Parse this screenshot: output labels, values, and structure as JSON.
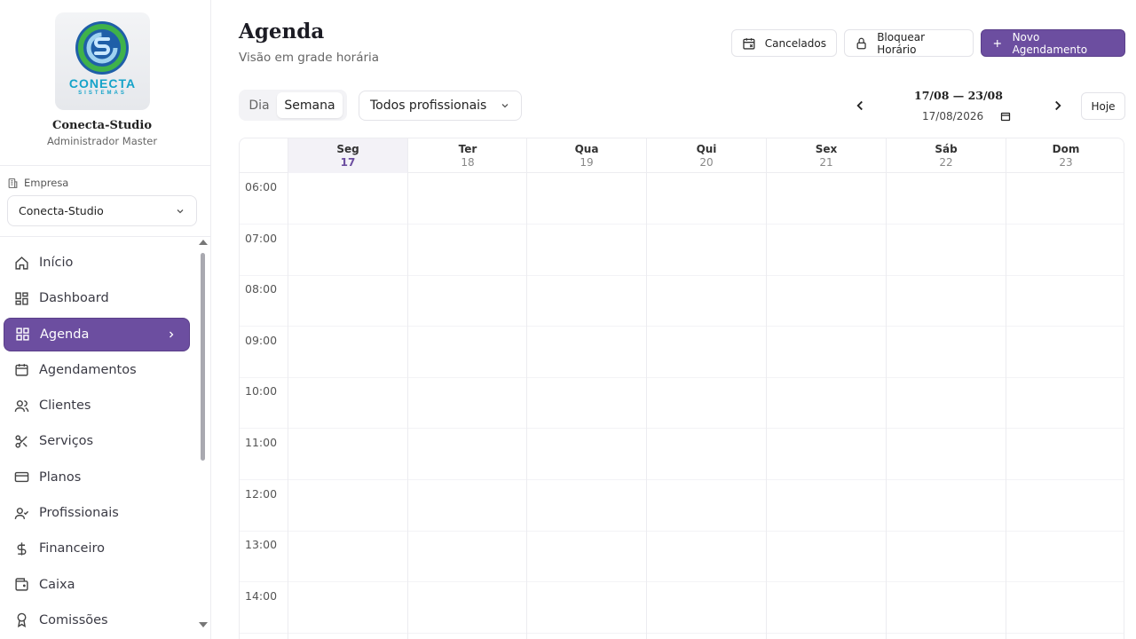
{
  "sidebar": {
    "logo": {
      "text": "CONECTA",
      "sub": "SISTEMAS"
    },
    "org_name": "Conecta-Studio",
    "role": "Administrador Master",
    "empresa_label": "Empresa",
    "empresa_value": "Conecta-Studio",
    "nav": [
      {
        "label": "Início",
        "icon": "home-icon"
      },
      {
        "label": "Dashboard",
        "icon": "dashboard-icon"
      },
      {
        "label": "Agenda",
        "icon": "grid-icon",
        "active": true
      },
      {
        "label": "Agendamentos",
        "icon": "calendar-icon"
      },
      {
        "label": "Clientes",
        "icon": "users-icon"
      },
      {
        "label": "Serviços",
        "icon": "scissors-icon"
      },
      {
        "label": "Planos",
        "icon": "card-icon"
      },
      {
        "label": "Profissionais",
        "icon": "user-check-icon"
      },
      {
        "label": "Financeiro",
        "icon": "dollar-icon"
      },
      {
        "label": "Caixa",
        "icon": "wallet-icon"
      },
      {
        "label": "Comissões",
        "icon": "award-icon"
      }
    ]
  },
  "header": {
    "title": "Agenda",
    "subtitle": "Visão em grade horária",
    "cancelados": "Cancelados",
    "bloquear": "Bloquear Horário",
    "novo": "Novo Agendamento"
  },
  "toolbar": {
    "view_dia": "Dia",
    "view_semana": "Semana",
    "profissional": "Todos profissionais",
    "range": "17/08 — 23/08",
    "date_value": "17/08/2026",
    "hoje": "Hoje"
  },
  "calendar": {
    "days": [
      {
        "name": "Seg",
        "num": "17",
        "today": true
      },
      {
        "name": "Ter",
        "num": "18"
      },
      {
        "name": "Qua",
        "num": "19"
      },
      {
        "name": "Qui",
        "num": "20"
      },
      {
        "name": "Sex",
        "num": "21"
      },
      {
        "name": "Sáb",
        "num": "22"
      },
      {
        "name": "Dom",
        "num": "23"
      }
    ],
    "times": [
      "06:00",
      "07:00",
      "08:00",
      "09:00",
      "10:00",
      "11:00",
      "12:00",
      "13:00",
      "14:00"
    ]
  },
  "colors": {
    "accent": "#6c4ea0",
    "border": "#ececf0"
  }
}
